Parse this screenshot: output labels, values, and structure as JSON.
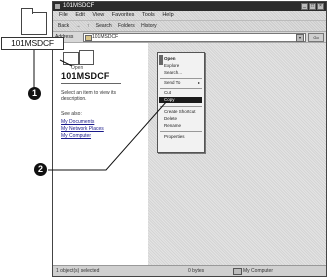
{
  "window": {
    "title": "101MSDCF",
    "controls": [
      "_",
      "□",
      "×"
    ]
  },
  "menubar": [
    "File",
    "Edit",
    "View",
    "Favorites",
    "Tools",
    "Help"
  ],
  "toolbar": {
    "back": "Back",
    "forward": "→",
    "up": "↑",
    "search": "Search",
    "folders": "Folders",
    "history": "History"
  },
  "address": {
    "label": "Address",
    "value": "101MSDCF",
    "go": "Go"
  },
  "leftpane": {
    "sub_label": "Open",
    "folder_name": "101MSDCF",
    "description": "Select an item to view its description.",
    "see_also": "See also:",
    "links": [
      "My Documents",
      "My Network Places",
      "My Computer"
    ]
  },
  "context_menu": {
    "items": [
      {
        "label": "Open",
        "submenu": false
      },
      {
        "label": "Explore",
        "submenu": false
      },
      {
        "label": "Search...",
        "submenu": false
      },
      {
        "label": "Send To",
        "submenu": true
      },
      {
        "label": "Cut",
        "submenu": false
      },
      {
        "label": "Copy",
        "submenu": false,
        "selected": true
      },
      {
        "label": "Create Shortcut",
        "submenu": false
      },
      {
        "label": "Delete",
        "submenu": false
      },
      {
        "label": "Rename",
        "submenu": false
      },
      {
        "label": "Properties",
        "submenu": false
      }
    ]
  },
  "statusbar": {
    "left": "1 object(s) selected",
    "middle": "0 bytes",
    "right": "My Computer"
  },
  "callouts": {
    "folder_label": "101MSDCF",
    "markers": [
      "1",
      "2"
    ]
  }
}
